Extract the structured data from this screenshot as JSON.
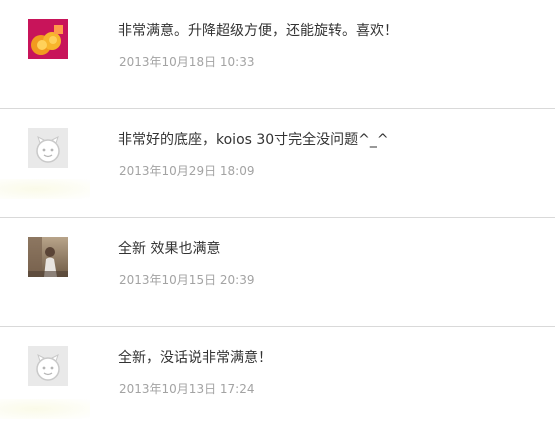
{
  "reviews": [
    {
      "avatar": "red-gift-avatar",
      "comment": "非常满意。升降超级方便，还能旋转。喜欢！",
      "date": "2013年10月18日 10:33"
    },
    {
      "avatar": "default-face-avatar",
      "comment": "非常好的底座，koios 30寸完全没问题^_^",
      "date": "2013年10月29日 18:09"
    },
    {
      "avatar": "photo-person-avatar",
      "comment": "全新 效果也满意",
      "date": "2013年10月15日 20:39"
    },
    {
      "avatar": "default-face-avatar",
      "comment": "全新，没话说非常满意！",
      "date": "2013年10月13日 17:24"
    }
  ],
  "colors": {
    "divider": "#d9d9d9",
    "comment_text": "#333333",
    "timestamp_text": "#a3a3a3",
    "avatar_red_bg": "#c8145a",
    "avatar_orange": "#f29a1f",
    "default_avatar_bg": "#e9e9e9"
  }
}
